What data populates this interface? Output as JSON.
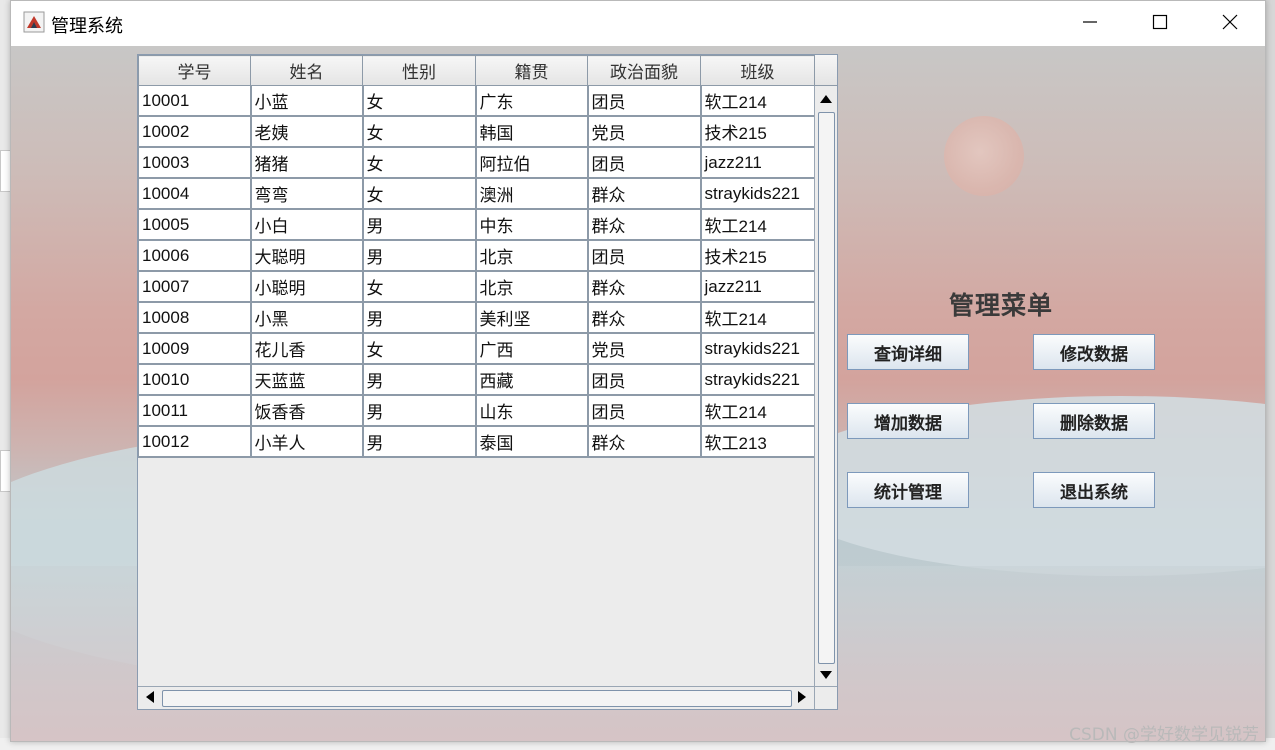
{
  "window": {
    "title": "管理系统",
    "controls": {
      "minimize_icon": "minimize-icon",
      "maximize_icon": "maximize-icon",
      "close_icon": "close-icon"
    }
  },
  "table": {
    "columns": [
      "学号",
      "姓名",
      "性别",
      "籍贯",
      "政治面貌",
      "班级"
    ],
    "rows": [
      [
        "10001",
        "小蓝",
        "女",
        "广东",
        "团员",
        "软工214"
      ],
      [
        "10002",
        "老姨",
        "女",
        "韩国",
        "党员",
        "技术215"
      ],
      [
        "10003",
        "猪猪",
        "女",
        "阿拉伯",
        "团员",
        "jazz211"
      ],
      [
        "10004",
        "弯弯",
        "女",
        "澳洲",
        "群众",
        "straykids221"
      ],
      [
        "10005",
        "小白",
        "男",
        "中东",
        "群众",
        "软工214"
      ],
      [
        "10006",
        "大聪明",
        "男",
        "北京",
        "团员",
        "技术215"
      ],
      [
        "10007",
        "小聪明",
        "女",
        "北京",
        "群众",
        "jazz211"
      ],
      [
        "10008",
        "小黑",
        "男",
        "美利坚",
        "群众",
        "软工214"
      ],
      [
        "10009",
        "花儿香",
        "女",
        "广西",
        "党员",
        "straykids221"
      ],
      [
        "10010",
        "天蓝蓝",
        "男",
        "西藏",
        "团员",
        "straykids221"
      ],
      [
        "10011",
        "饭香香",
        "男",
        "山东",
        "团员",
        "软工214"
      ],
      [
        "10012",
        "小羊人",
        "男",
        "泰国",
        "群众",
        "软工213"
      ]
    ]
  },
  "menu": {
    "title": "管理菜单",
    "buttons": {
      "query": "查询详细",
      "modify": "修改数据",
      "add": "增加数据",
      "delete": "删除数据",
      "stats": "统计管理",
      "exit": "退出系统"
    }
  },
  "watermark": "CSDN @学好数学见锐芳"
}
